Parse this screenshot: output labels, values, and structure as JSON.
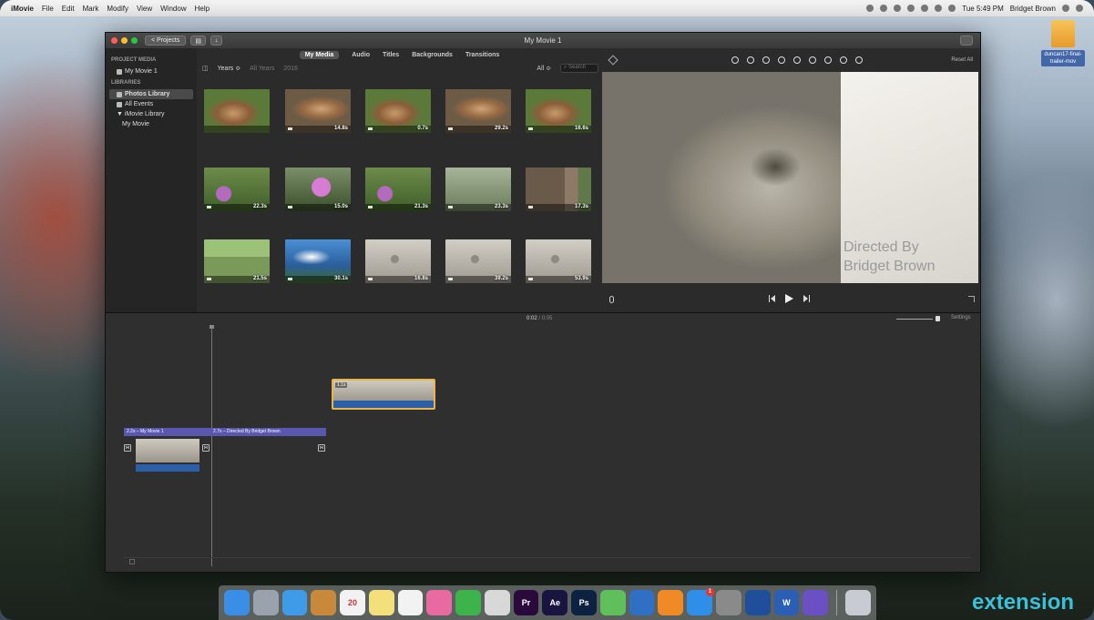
{
  "menubar": {
    "app_name": "iMovie",
    "menus": [
      "File",
      "Edit",
      "Mark",
      "Modify",
      "View",
      "Window",
      "Help"
    ],
    "clock": "Tue 5:49 PM",
    "user": "Bridget Brown"
  },
  "desktop": {
    "file_caption": "duncan17-final-trailer-mov"
  },
  "window": {
    "title": "My Movie 1",
    "projects_button": "< Projects"
  },
  "sidebar": {
    "project_media_heading": "PROJECT MEDIA",
    "project_item": "My Movie 1",
    "libraries_heading": "LIBRARIES",
    "items": [
      {
        "label": "Photos Library",
        "selected": true
      },
      {
        "label": "All Events",
        "selected": false
      },
      {
        "label": "▼ iMovie Library",
        "selected": false
      },
      {
        "label": "My Movie",
        "selected": false
      }
    ]
  },
  "media_tabs": [
    "My Media",
    "Audio",
    "Titles",
    "Backgrounds",
    "Transitions"
  ],
  "active_tab": "My Media",
  "filter": {
    "years": "Years ≎",
    "all_years": "All Years",
    "year": "2016",
    "all": "All ≎",
    "search_placeholder": "Search"
  },
  "clips": [
    {
      "duration": "",
      "scene": "rock"
    },
    {
      "duration": "14.8s",
      "scene": "rock2"
    },
    {
      "duration": "0.7s",
      "scene": "rock"
    },
    {
      "duration": "29.2s",
      "scene": "rock2"
    },
    {
      "duration": "16.6s",
      "scene": "rock"
    },
    {
      "duration": "22.3s",
      "scene": "flowers"
    },
    {
      "duration": "15.0s",
      "scene": "flowers2"
    },
    {
      "duration": "21.3s",
      "scene": "flowers"
    },
    {
      "duration": "23.3s",
      "scene": "bench"
    },
    {
      "duration": "17.3s",
      "scene": "tree"
    },
    {
      "duration": "21.5s",
      "scene": "field"
    },
    {
      "duration": "30.1s",
      "scene": "sky"
    },
    {
      "duration": "16.8s",
      "scene": "water"
    },
    {
      "duration": "39.2s",
      "scene": "water"
    },
    {
      "duration": "53.9s",
      "scene": "water"
    }
  ],
  "viewer": {
    "reset_all": "Reset All",
    "credit_line1": "Directed By",
    "credit_line2": "Bridget Brown"
  },
  "timeline": {
    "current_time": "0:02",
    "separator": " / ",
    "total_time": "0:05",
    "settings": "Settings",
    "overlay_duration": "1.1s",
    "title1": "2.2s – My Movie 1",
    "title2": "2.7s – Directed By Bridget Brown"
  },
  "dock": {
    "apps": [
      "Finder",
      "Launchpad",
      "Safari",
      "Contacts",
      "Calendar",
      "Notes",
      "Reminders",
      "Photos",
      "FaceTime",
      "Preview",
      "Pr",
      "Ae",
      "Ps",
      "Numbers",
      "Keynote",
      "iBooks",
      "App Store",
      "System Preferences",
      "QuickTime",
      "Word",
      "iMovie",
      "Trash"
    ],
    "calendar_day": "20",
    "app_store_badge": "1"
  },
  "brand": "extension"
}
